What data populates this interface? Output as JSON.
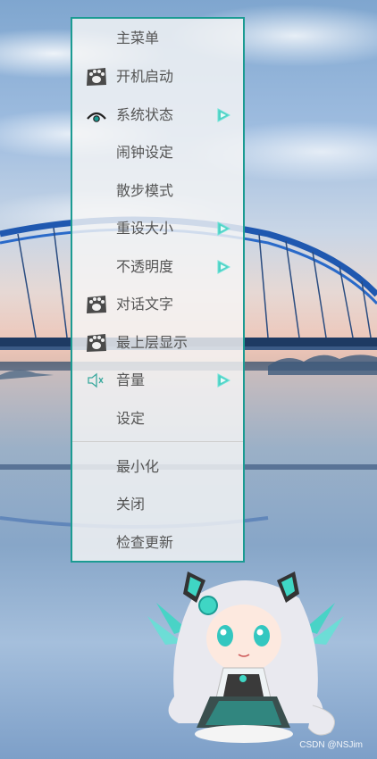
{
  "menu": {
    "items": [
      {
        "label": "主菜单",
        "icon": "none",
        "submenu": false
      },
      {
        "label": "开机启动",
        "icon": "paw-icon",
        "submenu": false
      },
      {
        "label": "系统状态",
        "icon": "eye-icon",
        "submenu": true
      },
      {
        "label": "闹钟设定",
        "icon": "none",
        "submenu": false
      },
      {
        "label": "散步模式",
        "icon": "none",
        "submenu": false
      },
      {
        "label": "重设大小",
        "icon": "none",
        "submenu": true
      },
      {
        "label": "不透明度",
        "icon": "none",
        "submenu": true
      },
      {
        "label": "对话文字",
        "icon": "paw-icon",
        "submenu": false
      },
      {
        "label": "最上层显示",
        "icon": "paw-icon",
        "submenu": false
      },
      {
        "label": "音量",
        "icon": "speaker-icon",
        "submenu": true
      },
      {
        "label": "设定",
        "icon": "none",
        "submenu": false
      },
      {
        "label": "最小化",
        "icon": "none",
        "submenu": false
      },
      {
        "label": "关闭",
        "icon": "none",
        "submenu": false
      },
      {
        "label": "检查更新",
        "icon": "none",
        "submenu": false
      }
    ]
  },
  "colors": {
    "menu_border": "#1b9b92",
    "submenu_arrow": "#4fd1c5",
    "paw_icon": "#4a4a4a"
  },
  "watermark": "CSDN @NSJim"
}
